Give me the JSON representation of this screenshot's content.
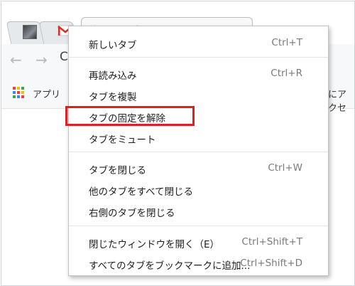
{
  "browser": {
    "active_tab_title": "新しいタブ",
    "bookmarks_bar": {
      "apps_label": "アプリ",
      "right_fragment": "にアクセ"
    },
    "omnibox_fragment": "C"
  },
  "context_menu": {
    "items": [
      {
        "label": "新しいタブ",
        "shortcut": "Ctrl+T"
      },
      {
        "label": "再読み込み",
        "shortcut": "Ctrl+R"
      },
      {
        "label": "タブを複製",
        "shortcut": ""
      },
      {
        "label": "タブの固定を解除",
        "shortcut": ""
      },
      {
        "label": "タブをミュート",
        "shortcut": ""
      },
      {
        "label": "タブを閉じる",
        "shortcut": "Ctrl+W"
      },
      {
        "label": "他のタブをすべて閉じる",
        "shortcut": ""
      },
      {
        "label": "右側のタブを閉じる",
        "shortcut": ""
      },
      {
        "label": "閉じたウィンドウを開く（E）",
        "shortcut": "Ctrl+Shift+T"
      },
      {
        "label": "すべてのタブをブックマークに追加...",
        "shortcut": "Ctrl+Shift+D"
      }
    ]
  },
  "icons": {
    "apps_grid_colors": [
      "#ea4335",
      "#fbbc05",
      "#34a853",
      "#4285f4",
      "#ea4335",
      "#fbbc05",
      "#34a853",
      "#4285f4",
      "#ea4335"
    ],
    "highlight_color": "#e02020"
  }
}
